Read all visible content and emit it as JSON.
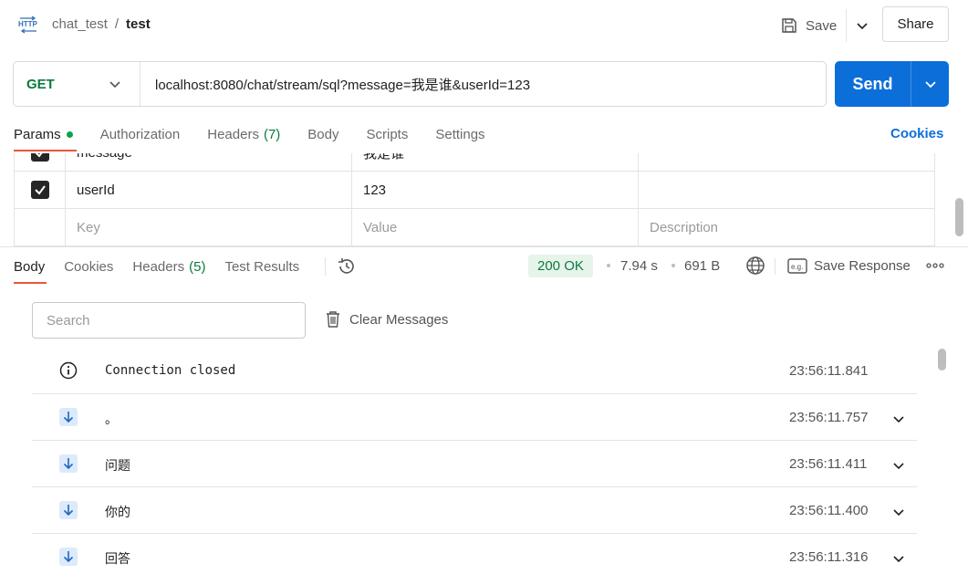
{
  "header": {
    "collection": "chat_test",
    "separator": "/",
    "request_name": "test",
    "save_label": "Save",
    "share_label": "Share"
  },
  "request": {
    "method": "GET",
    "url": "localhost:8080/chat/stream/sql?message=我是谁&userId=123",
    "send_label": "Send",
    "tabs": [
      {
        "label": "Params",
        "active": true
      },
      {
        "label": "Authorization"
      },
      {
        "label": "Headers",
        "count": "(7)"
      },
      {
        "label": "Body"
      },
      {
        "label": "Scripts"
      },
      {
        "label": "Settings"
      }
    ],
    "cookies_label": "Cookies"
  },
  "params": {
    "rows": [
      {
        "key": "message",
        "value": "我是谁",
        "description": "",
        "checked": true
      },
      {
        "key": "userId",
        "value": "123",
        "description": "",
        "checked": true
      }
    ],
    "key_placeholder": "Key",
    "value_placeholder": "Value",
    "description_placeholder": "Description"
  },
  "response": {
    "tabs": [
      {
        "label": "Body",
        "active": true
      },
      {
        "label": "Cookies"
      },
      {
        "label": "Headers",
        "count": "(5)"
      },
      {
        "label": "Test Results"
      }
    ],
    "status": "200 OK",
    "time": "7.94 s",
    "size": "691 B",
    "save_response_label": "Save Response",
    "search_placeholder": "Search",
    "clear_label": "Clear Messages",
    "messages": [
      {
        "type": "info",
        "text": "Connection closed",
        "time": "23:56:11.841"
      },
      {
        "type": "incoming",
        "text": "。",
        "time": "23:56:11.757"
      },
      {
        "type": "incoming",
        "text": "问题",
        "time": "23:56:11.411"
      },
      {
        "type": "incoming",
        "text": "你的",
        "time": "23:56:11.400"
      },
      {
        "type": "incoming",
        "text": "回答",
        "time": "23:56:11.316"
      }
    ]
  },
  "colors": {
    "method_green": "#0b7a3e",
    "send_blue": "#0c6fd9",
    "tab_accent": "#e8573c",
    "status_bg": "#e6f4ea"
  },
  "icons": [
    "http-icon",
    "save-icon",
    "chevron-down-icon",
    "history-icon",
    "globe-icon",
    "example-icon",
    "more-icon",
    "trash-icon",
    "info-icon",
    "arrow-down-icon"
  ]
}
